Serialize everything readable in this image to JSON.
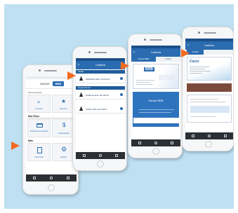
{
  "phone1": {
    "logo_label": "SAÚDE",
    "brand": "BRB",
    "section_title": "Meus Serviços",
    "section2_title": "Meu Plano",
    "section3_title": "Mais",
    "tiles": [
      {
        "label": "Consulta",
        "icon": "search-icon"
      },
      {
        "label": "Favoritos",
        "icon": "star-icon"
      },
      {
        "label": "Carteira de Identificação",
        "icon": "card-icon"
      },
      {
        "label": "Coparticipação",
        "icon": "dollar-icon"
      },
      {
        "label": "Protocolos",
        "icon": "clipboard-icon"
      },
      {
        "label": "Ajustes",
        "icon": "gear-icon"
      }
    ]
  },
  "phone2": {
    "title": "Carteira",
    "group1": "Titular",
    "group2": "Dependentes",
    "people": [
      "AMANDA LEAL DA SILVA",
      "GISELE LEAL DA SILVA",
      "JOÃO LEAL DA SILVA"
    ]
  },
  "phone3": {
    "title": "Carteira",
    "tabs": [
      "Saúde BRB",
      "CASSI"
    ],
    "card_brand": "BRB",
    "card_caption": "Saúde BRB",
    "card_watermark": "BRB"
  },
  "phone4": {
    "title": "Carteira",
    "tabs": [
      "CASSI"
    ],
    "brand": "Cassi"
  },
  "colors": {
    "background": "#bfe0f2",
    "primary": "#2b6cb0",
    "accent_arrow": "#f26a21"
  }
}
